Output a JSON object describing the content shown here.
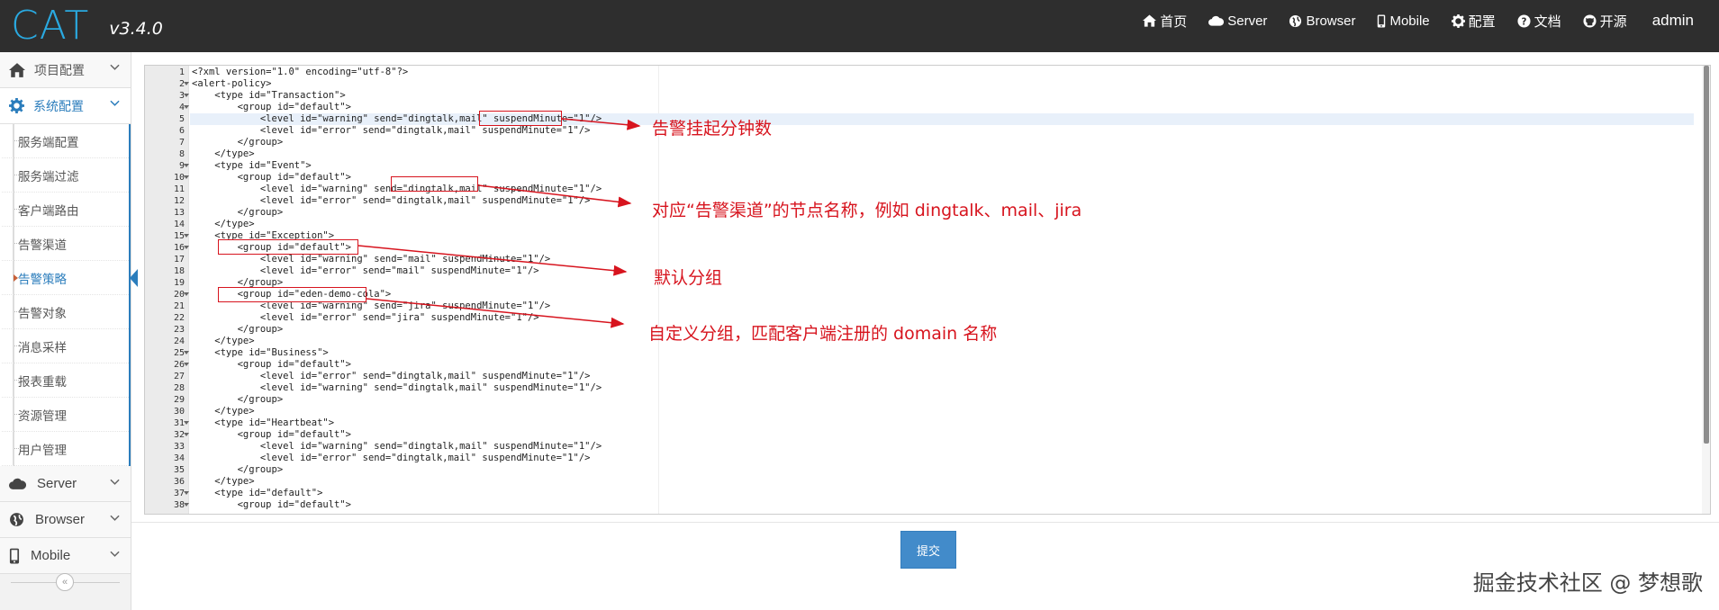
{
  "header": {
    "logo": "CAT",
    "version": "v3.4.0",
    "nav": [
      {
        "label": "首页",
        "icon": "home-icon"
      },
      {
        "label": "Server",
        "icon": "cloud-icon"
      },
      {
        "label": "Browser",
        "icon": "globe-icon"
      },
      {
        "label": "Mobile",
        "icon": "mobile-icon"
      },
      {
        "label": "配置",
        "icon": "gear-icon"
      },
      {
        "label": "文档",
        "icon": "question-circle-icon"
      },
      {
        "label": "开源",
        "icon": "github-icon"
      }
    ],
    "user": "admin"
  },
  "sidebar": {
    "project": {
      "label": "项目配置",
      "icon": "home-icon"
    },
    "system": {
      "label": "系统配置",
      "icon": "gear-icon"
    },
    "sub_items": [
      "服务端配置",
      "服务端过滤",
      "客户端路由",
      "告警渠道",
      "告警策略",
      "告警对象",
      "消息采样",
      "报表重载",
      "资源管理",
      "用户管理"
    ],
    "active_index": 4,
    "groups": [
      {
        "label": "Server",
        "icon": "cloud-icon"
      },
      {
        "label": "Browser",
        "icon": "globe-icon"
      },
      {
        "label": "Mobile",
        "icon": "mobile-icon"
      }
    ],
    "collapse_glyph": "«"
  },
  "editor": {
    "lines": [
      {
        "no": "1",
        "fold": false,
        "text": "<?xml version=\"1.0\" encoding=\"utf-8\"?>"
      },
      {
        "no": "2",
        "fold": true,
        "text": "<alert-policy>"
      },
      {
        "no": "3",
        "fold": true,
        "text": "    <type id=\"Transaction\">"
      },
      {
        "no": "4",
        "fold": true,
        "text": "        <group id=\"default\">"
      },
      {
        "no": "5",
        "fold": false,
        "text": "            <level id=\"warning\" send=\"dingtalk,mail\" suspendMinute=\"1\"/>"
      },
      {
        "no": "6",
        "fold": false,
        "text": "            <level id=\"error\" send=\"dingtalk,mail\" suspendMinute=\"1\"/>"
      },
      {
        "no": "7",
        "fold": false,
        "text": "        </group>"
      },
      {
        "no": "8",
        "fold": false,
        "text": "    </type>"
      },
      {
        "no": "9",
        "fold": true,
        "text": "    <type id=\"Event\">"
      },
      {
        "no": "10",
        "fold": true,
        "text": "        <group id=\"default\">"
      },
      {
        "no": "11",
        "fold": false,
        "text": "            <level id=\"warning\" send=\"dingtalk,mail\" suspendMinute=\"1\"/>"
      },
      {
        "no": "12",
        "fold": false,
        "text": "            <level id=\"error\" send=\"dingtalk,mail\" suspendMinute=\"1\"/>"
      },
      {
        "no": "13",
        "fold": false,
        "text": "        </group>"
      },
      {
        "no": "14",
        "fold": false,
        "text": "    </type>"
      },
      {
        "no": "15",
        "fold": true,
        "text": "    <type id=\"Exception\">"
      },
      {
        "no": "16",
        "fold": true,
        "text": "        <group id=\"default\">"
      },
      {
        "no": "17",
        "fold": false,
        "text": "            <level id=\"warning\" send=\"mail\" suspendMinute=\"1\"/>"
      },
      {
        "no": "18",
        "fold": false,
        "text": "            <level id=\"error\" send=\"mail\" suspendMinute=\"1\"/>"
      },
      {
        "no": "19",
        "fold": false,
        "text": "        </group>"
      },
      {
        "no": "20",
        "fold": true,
        "text": "        <group id=\"eden-demo-cola\">"
      },
      {
        "no": "21",
        "fold": false,
        "text": "            <level id=\"warning\" send=\"jira\" suspendMinute=\"1\"/>"
      },
      {
        "no": "22",
        "fold": false,
        "text": "            <level id=\"error\" send=\"jira\" suspendMinute=\"1\"/>"
      },
      {
        "no": "23",
        "fold": false,
        "text": "        </group>"
      },
      {
        "no": "24",
        "fold": false,
        "text": "    </type>"
      },
      {
        "no": "25",
        "fold": true,
        "text": "    <type id=\"Business\">"
      },
      {
        "no": "26",
        "fold": true,
        "text": "        <group id=\"default\">"
      },
      {
        "no": "27",
        "fold": false,
        "text": "            <level id=\"error\" send=\"dingtalk,mail\" suspendMinute=\"1\"/>"
      },
      {
        "no": "28",
        "fold": false,
        "text": "            <level id=\"warning\" send=\"dingtalk,mail\" suspendMinute=\"1\"/>"
      },
      {
        "no": "29",
        "fold": false,
        "text": "        </group>"
      },
      {
        "no": "30",
        "fold": false,
        "text": "    </type>"
      },
      {
        "no": "31",
        "fold": true,
        "text": "    <type id=\"Heartbeat\">"
      },
      {
        "no": "32",
        "fold": true,
        "text": "        <group id=\"default\">"
      },
      {
        "no": "33",
        "fold": false,
        "text": "            <level id=\"warning\" send=\"dingtalk,mail\" suspendMinute=\"1\"/>"
      },
      {
        "no": "34",
        "fold": false,
        "text": "            <level id=\"error\" send=\"dingtalk,mail\" suspendMinute=\"1\"/>"
      },
      {
        "no": "35",
        "fold": false,
        "text": "        </group>"
      },
      {
        "no": "36",
        "fold": false,
        "text": "    </type>"
      },
      {
        "no": "37",
        "fold": true,
        "text": "    <type id=\"default\">"
      },
      {
        "no": "38",
        "fold": true,
        "text": "        <group id=\"default\">"
      }
    ],
    "active_line": 5
  },
  "annotations": [
    "告警挂起分钟数",
    "对应“告警渠道”的节点名称，例如 dingtalk、mail、jira",
    "默认分组",
    "自定义分组，匹配客户端注册的 domain 名称"
  ],
  "submit_label": "提交",
  "watermark": "掘金技术社区 @ 梦想歌",
  "colors": {
    "accent": "#2b7dbc",
    "button": "#428bca",
    "annotation": "#d7141e",
    "topbar": "#2e2e2e"
  }
}
